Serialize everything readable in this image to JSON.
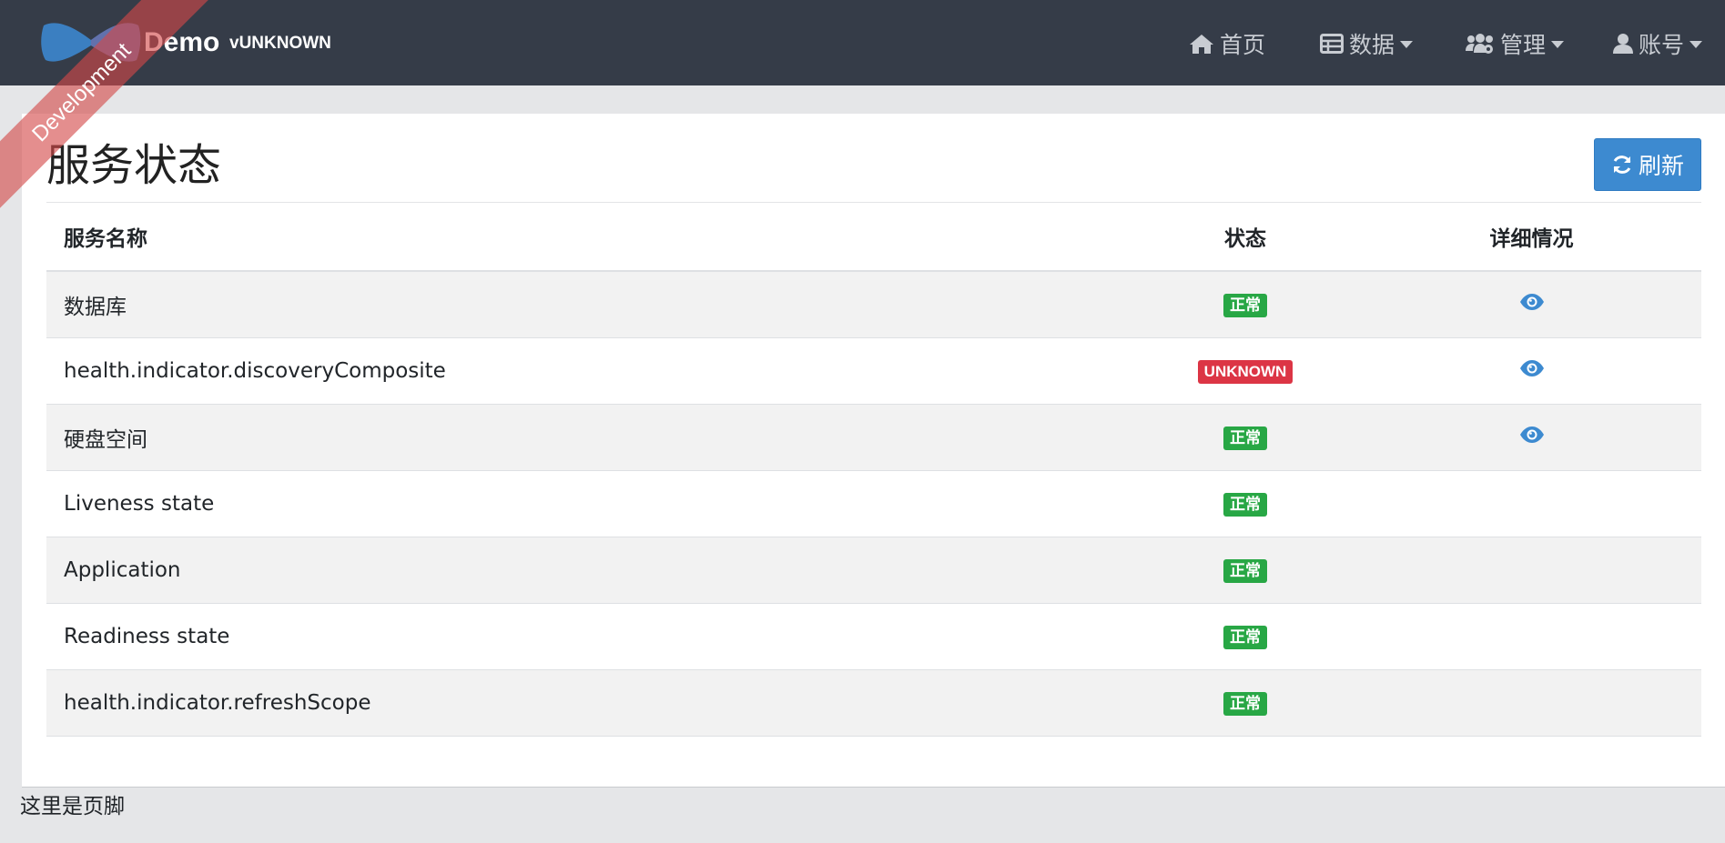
{
  "navbar": {
    "brand_name": "Demo",
    "brand_version": "vUNKNOWN",
    "env_ribbon": "Development",
    "items": [
      {
        "label": "首页",
        "icon": "home-icon",
        "dropdown": false
      },
      {
        "label": "数据",
        "icon": "table-icon",
        "dropdown": true
      },
      {
        "label": "管理",
        "icon": "users-icon",
        "dropdown": true
      },
      {
        "label": "账号",
        "icon": "user-icon",
        "dropdown": true
      }
    ]
  },
  "page": {
    "title": "服务状态",
    "refresh_label": "刷新"
  },
  "table": {
    "columns": [
      "服务名称",
      "状态",
      "详细情况"
    ],
    "rows": [
      {
        "name": "数据库",
        "status": "正常",
        "has_details": true
      },
      {
        "name": "health.indicator.discoveryComposite",
        "status": "UNKNOWN",
        "has_details": true
      },
      {
        "name": "硬盘空间",
        "status": "正常",
        "has_details": true
      },
      {
        "name": "Liveness state",
        "status": "正常",
        "has_details": false
      },
      {
        "name": "Application",
        "status": "正常",
        "has_details": false
      },
      {
        "name": "Readiness state",
        "status": "正常",
        "has_details": false
      },
      {
        "name": "health.indicator.refreshScope",
        "status": "正常",
        "has_details": false
      }
    ]
  },
  "footer": {
    "text": "这里是页脚"
  },
  "colors": {
    "navbar_bg": "#353c48",
    "primary": "#3d8ad0",
    "status_ok": "#28a745",
    "status_unknown": "#dc3545",
    "ribbon": "#d44848"
  }
}
